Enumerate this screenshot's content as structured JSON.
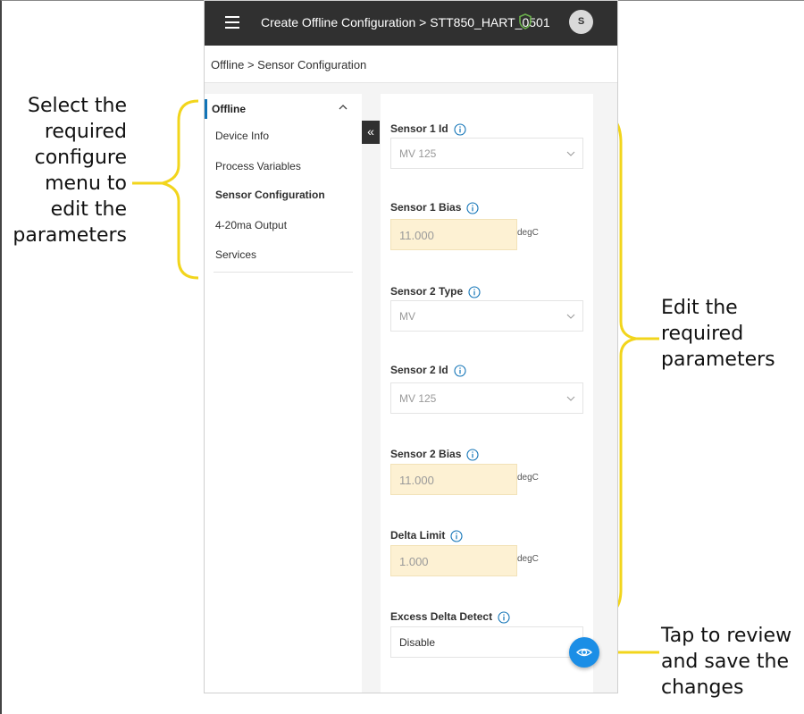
{
  "topbar": {
    "title": "Create Offline Configuration > STT850_HART_0501",
    "avatar_initial": "S",
    "menu_icon": "hamburger-menu-icon",
    "status_icon": "shield-icon",
    "status_color": "#6ab04c"
  },
  "breadcrumb": "Offline > Sensor Configuration",
  "sidebar": {
    "header": "Offline",
    "items": [
      {
        "label": "Device Info",
        "active": false
      },
      {
        "label": "Process Variables",
        "active": false
      },
      {
        "label": "Sensor Configuration",
        "active": true
      },
      {
        "label": "4-20ma Output",
        "active": false
      },
      {
        "label": "Services",
        "active": false
      }
    ],
    "collapse_glyph": "«"
  },
  "fields": [
    {
      "label": "Sensor 1 Id",
      "type": "select",
      "value": "MV 125"
    },
    {
      "label": "Sensor 1 Bias",
      "type": "number",
      "value": "11.000",
      "unit": "degC"
    },
    {
      "label": "Sensor 2 Type",
      "type": "select",
      "value": "MV"
    },
    {
      "label": "Sensor 2 Id",
      "type": "select",
      "value": "MV 125"
    },
    {
      "label": "Sensor 2 Bias",
      "type": "number",
      "value": "11.000",
      "unit": "degC"
    },
    {
      "label": "Delta Limit",
      "type": "number",
      "value": "1.000",
      "unit": "degC"
    },
    {
      "label": "Excess Delta Detect",
      "type": "select",
      "value": "Disable"
    }
  ],
  "fab_icon": "eye-icon",
  "annotations": {
    "left_lines": [
      "Select the",
      "required",
      "configure",
      "menu to",
      "edit the",
      "parameters"
    ],
    "right_lines": [
      "Edit the",
      "required",
      "parameters"
    ],
    "bottom_lines": [
      "Tap to review",
      "and save the",
      "changes"
    ]
  },
  "colors": {
    "accent": "#1274b7",
    "topbar": "#303030",
    "highlight_input": "#fdf1d3",
    "bracket": "#f2d51c",
    "fab": "#1b8ee6"
  }
}
